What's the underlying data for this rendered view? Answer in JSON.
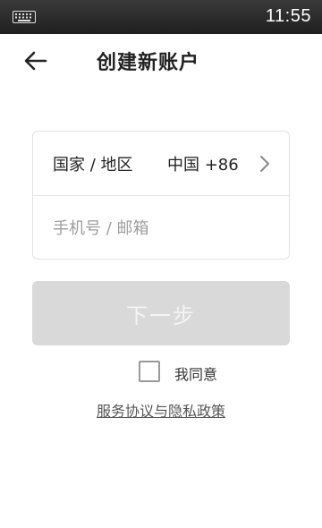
{
  "status_bar": {
    "time": "11:55",
    "keyboard_icon": "keyboard-icon"
  },
  "header": {
    "back_icon": "arrow-left-icon",
    "title": "创建新账户"
  },
  "form": {
    "country_label": "国家 / 地区",
    "country_value": "中国 +86",
    "chevron_icon": "chevron-right-icon",
    "phone_email_placeholder": "手机号 / 邮箱",
    "phone_email_value": ""
  },
  "actions": {
    "next_label": "下一步",
    "agree_label": "我同意",
    "agree_checked": false,
    "policy_link": "服务协议与隐私政策"
  },
  "colors": {
    "status_bar": "#2a2a2a",
    "button_disabled": "#d9d9d9",
    "card_border": "#e3e3e3"
  }
}
